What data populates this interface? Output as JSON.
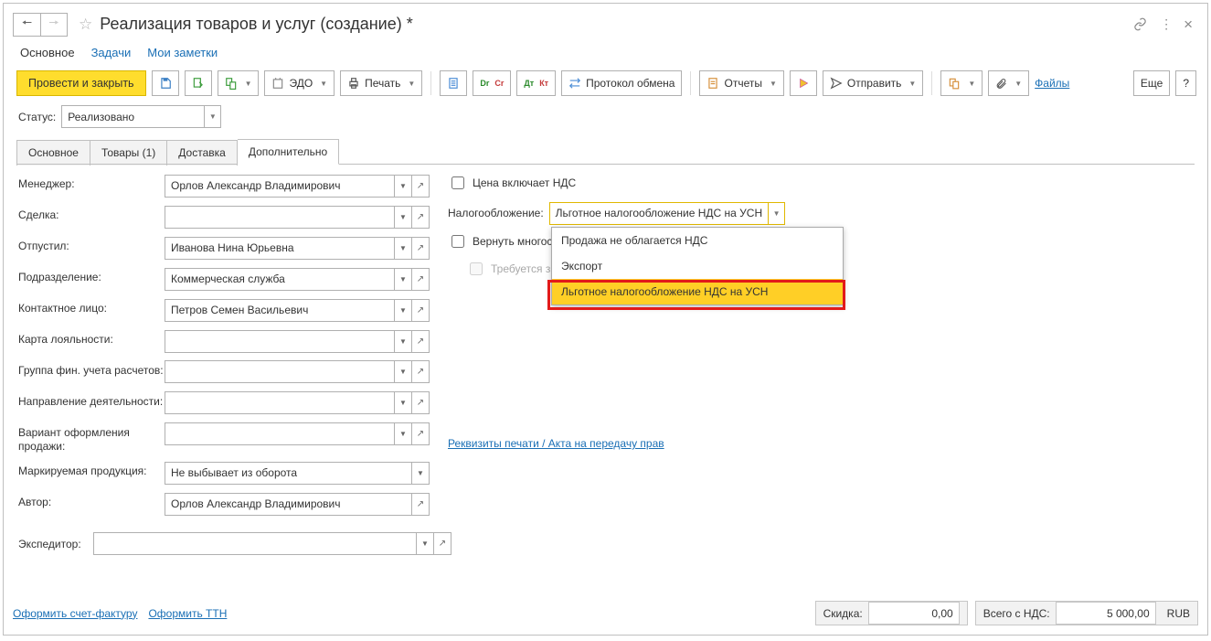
{
  "header": {
    "title": "Реализация товаров и услуг (создание) *"
  },
  "subnav": {
    "main": "Основное",
    "tasks": "Задачи",
    "notes": "Мои заметки"
  },
  "toolbar": {
    "post_close": "Провести и закрыть",
    "edo": "ЭДО",
    "print": "Печать",
    "protocol": "Протокол обмена",
    "reports": "Отчеты",
    "send": "Отправить",
    "files": "Файлы",
    "more": "Еще",
    "help": "?"
  },
  "status": {
    "label": "Статус:",
    "value": "Реализовано"
  },
  "tabs": {
    "t1": "Основное",
    "t2": "Товары (1)",
    "t3": "Доставка",
    "t4": "Дополнительно"
  },
  "left": {
    "manager_l": "Менеджер:",
    "manager_v": "Орлов Александр Владимирович",
    "deal_l": "Сделка:",
    "deal_v": "",
    "released_l": "Отпустил:",
    "released_v": "Иванова Нина Юрьевна",
    "dept_l": "Подразделение:",
    "dept_v": "Коммерческая служба",
    "contact_l": "Контактное лицо:",
    "contact_v": "Петров Семен Васильевич",
    "loyalty_l": "Карта лояльности:",
    "loyalty_v": "",
    "fingroup_l": "Группа фин. учета расчетов:",
    "fingroup_v": "",
    "direction_l": "Направление деятельности:",
    "direction_v": "",
    "variant_l": "Вариант оформления продажи:",
    "variant_v": "",
    "marking_l": "Маркируемая продукция:",
    "marking_v": "Не выбывает из оборота",
    "author_l": "Автор:",
    "author_v": "Орлов Александр Владимирович",
    "expeditor_l": "Экспедитор:",
    "expeditor_v": ""
  },
  "right": {
    "price_incl": "Цена включает НДС",
    "tax_l": "Налогообложение:",
    "tax_v": "Льготное налогообложение НДС на УСН",
    "return_l": "Вернуть многос",
    "assembly_l": "Требуется з",
    "requisites_link": "Реквизиты печати / Акта на передачу прав",
    "dropdown": {
      "o1": "Продажа не облагается НДС",
      "o2": "Экспорт",
      "o3": "Льготное налогообложение НДС на УСН"
    }
  },
  "bottom": {
    "invoice": "Оформить счет-фактуру",
    "ttn": "Оформить ТТН",
    "discount_l": "Скидка:",
    "discount_v": "0,00",
    "total_l": "Всего с НДС:",
    "total_v": "5 000,00",
    "currency": "RUB"
  }
}
